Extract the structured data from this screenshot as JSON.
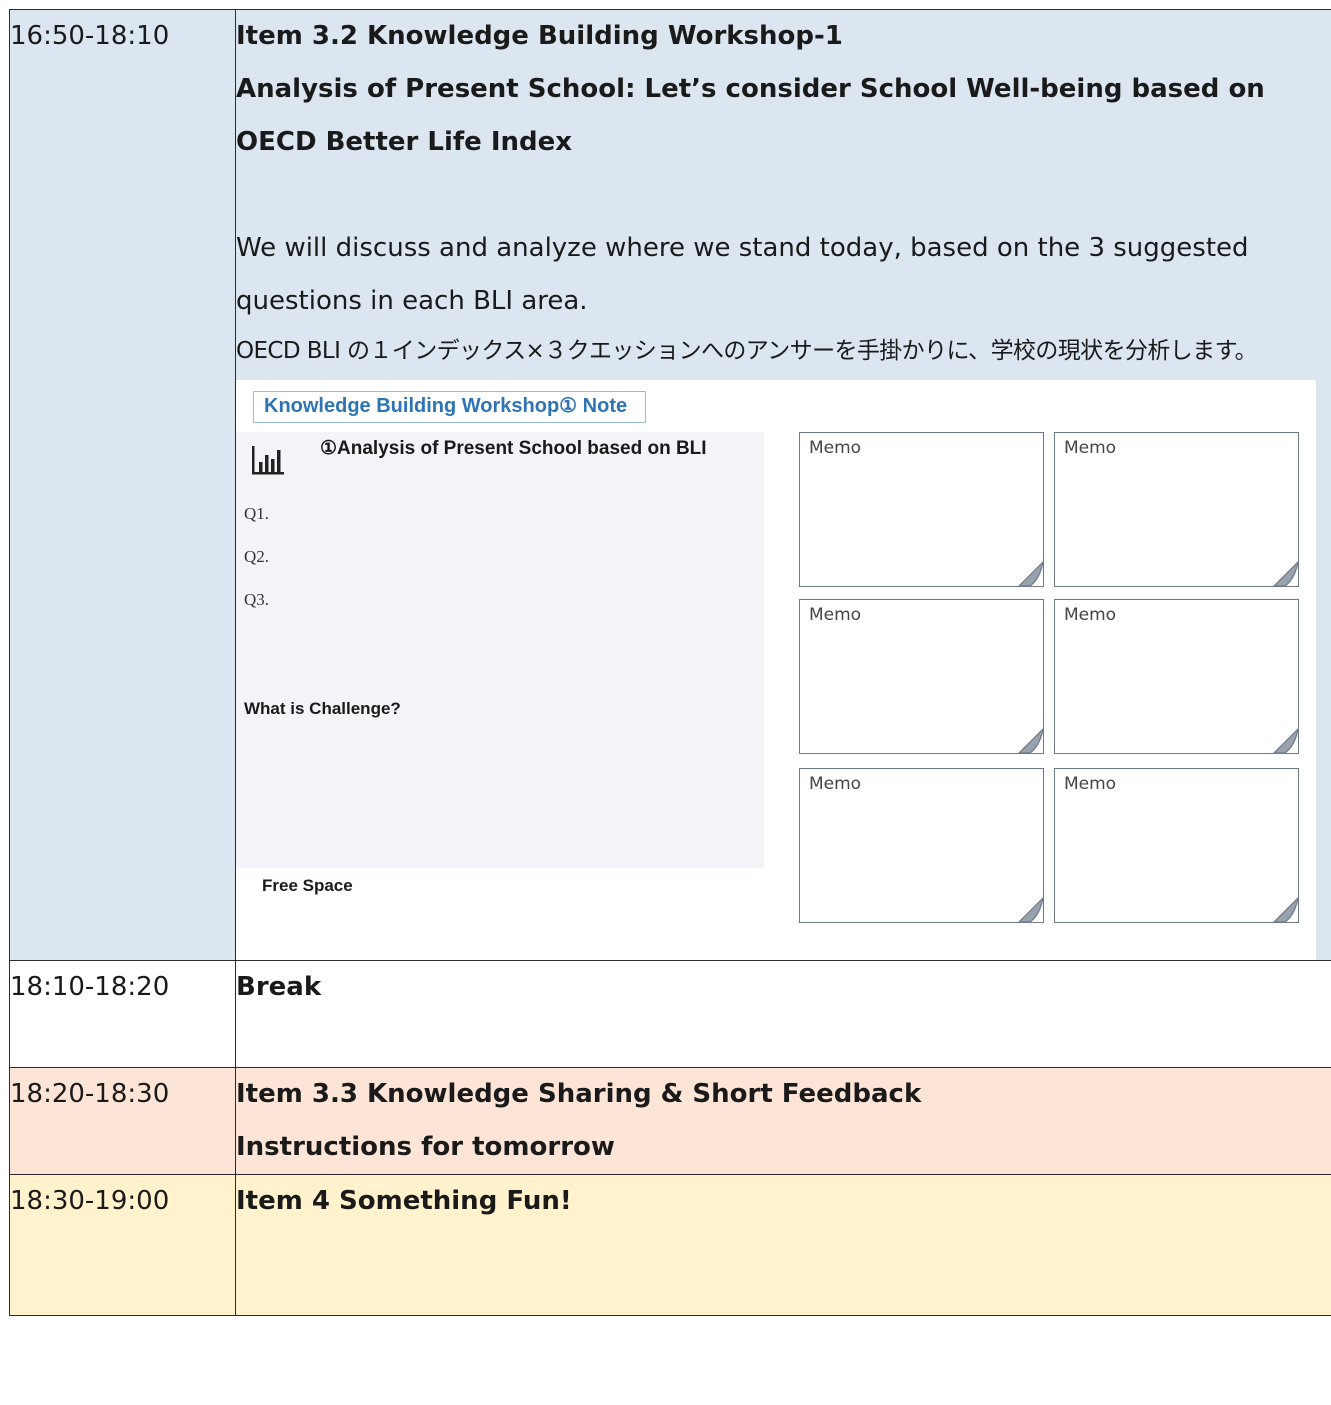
{
  "rows": [
    {
      "time": "16:50-18:10",
      "title_lines": [
        "Item 3.2 Knowledge Building Workshop-1",
        "Analysis of Present School: Let’s consider School Well-being based on",
        "OECD Better Life Index"
      ],
      "desc_lines": [
        "We will discuss and analyze where we stand today, based on the 3 suggested",
        "questions in each BLI area."
      ],
      "jp_line": "OECD BLI の１インデックス×３クエッションへのアンサーを手掛かりに、学校の現状を分析します。",
      "note": {
        "tag": "Knowledge Building Workshop① Note",
        "analysis_title": "①Analysis of Present School based on BLI",
        "questions": [
          "Q1.",
          "Q2.",
          "Q3."
        ],
        "challenge": "What is Challenge?",
        "free_space": "Free Space",
        "memos": [
          "Memo",
          "Memo",
          "Memo",
          "Memo",
          "Memo",
          "Memo"
        ]
      }
    },
    {
      "time": "18:10-18:20",
      "title_lines": [
        "Break"
      ]
    },
    {
      "time": "18:20-18:30",
      "title_lines": [
        "Item 3.3 Knowledge Sharing & Short Feedback",
        "Instructions for tomorrow"
      ]
    },
    {
      "time": "18:30-19:00",
      "title_lines": [
        "Item 4 Something Fun!"
      ]
    }
  ]
}
